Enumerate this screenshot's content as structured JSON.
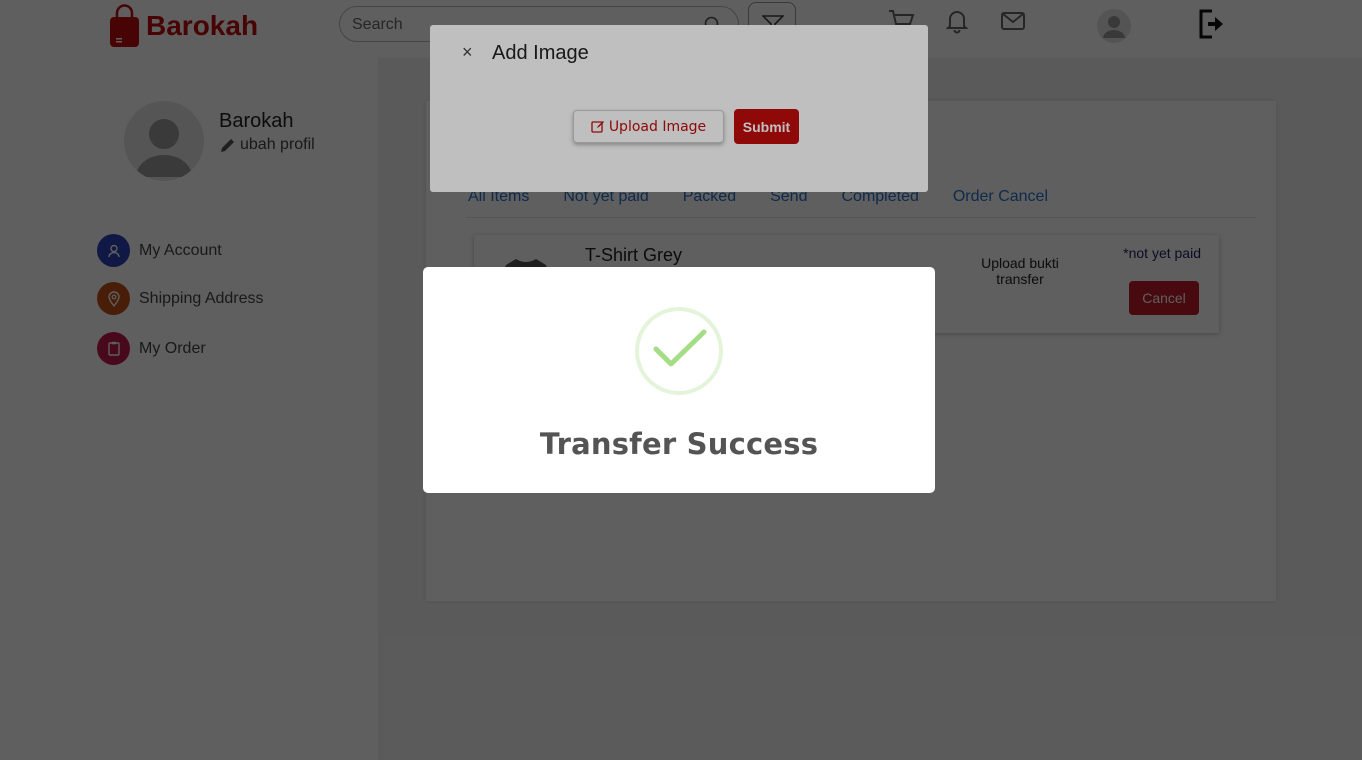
{
  "header": {
    "brand": "Barokah",
    "search_placeholder": "Search",
    "icons": [
      "filter-icon",
      "cart-icon",
      "bell-icon",
      "mail-icon",
      "user-avatar",
      "logout-icon"
    ]
  },
  "sidebar": {
    "profile_name": "Barokah",
    "edit_profile_label": "ubah profil",
    "items": [
      {
        "label": "My Account",
        "icon": "user-icon",
        "color": "#2c44b8"
      },
      {
        "label": "Shipping Address",
        "icon": "location-pin-icon",
        "color": "#c4501a"
      },
      {
        "label": "My Order",
        "icon": "clipboard-icon",
        "color": "#c4184e"
      }
    ]
  },
  "orders": {
    "tabs": [
      "All Items",
      "Not yet paid",
      "Packed",
      "Send",
      "Completed",
      "Order Cancel"
    ],
    "items": [
      {
        "title": "T-Shirt Grey",
        "upload_label": "Upload bukti transfer",
        "status": "*not yet paid",
        "cancel_label": "Cancel"
      }
    ]
  },
  "add_image_modal": {
    "close_symbol": "×",
    "title": "Add Image",
    "upload_label": "Upload Image",
    "submit_label": "Submit"
  },
  "success_modal": {
    "title": "Transfer Success",
    "icon": "check-icon"
  },
  "colors": {
    "brand": "#c00d0d",
    "tab_link": "#2a70c9",
    "success_check": "#a5dc86"
  }
}
